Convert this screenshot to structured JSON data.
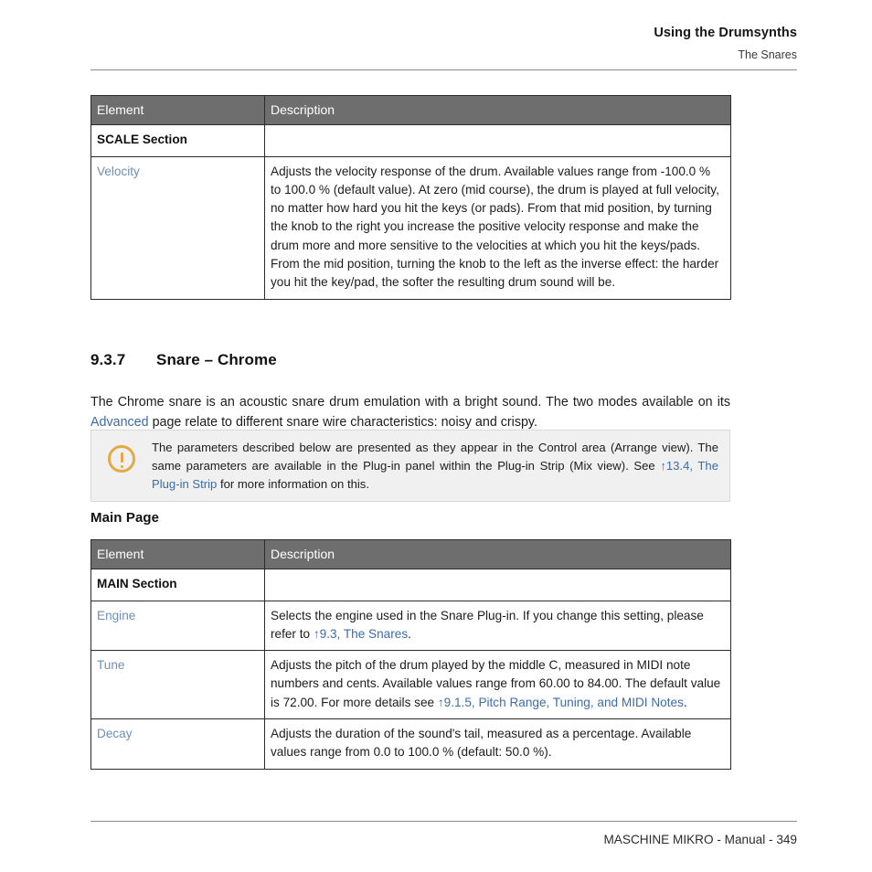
{
  "header": {
    "title": "Using the Drumsynths",
    "subtitle": "The Snares"
  },
  "tables": {
    "scale": {
      "columns": [
        "Element",
        "Description"
      ],
      "rows": [
        {
          "kind": "section",
          "element": "SCALE Section",
          "description": ""
        },
        {
          "kind": "param",
          "element": "Velocity",
          "description": "Adjusts the velocity response of the drum. Available values range from -100.0 % to 100.0 % (default value). At zero (mid course), the drum is played at full velocity, no matter how hard you hit the keys (or pads). From that mid position, by turning the knob to the right you increase the positive velocity response and make the drum more and more sensitive to the velocities at which you hit the keys/pads. From the mid position, turning the knob to the left as the inverse effect: the harder you hit the key/pad, the softer the resulting drum sound will be."
        }
      ]
    },
    "main": {
      "columns": [
        "Element",
        "Description"
      ],
      "rows": [
        {
          "kind": "section",
          "element": "MAIN Section",
          "description": ""
        },
        {
          "kind": "param",
          "element": "Engine",
          "description_parts": [
            {
              "type": "text",
              "value": "Selects the engine used in the Snare Plug-in. If you change this setting, please refer to "
            },
            {
              "type": "link",
              "value": "↑9.3, The Snares"
            },
            {
              "type": "text",
              "value": "."
            }
          ]
        },
        {
          "kind": "param",
          "element": "Tune",
          "description_parts": [
            {
              "type": "text",
              "value": "Adjusts the pitch of the drum played by the middle C, measured in MIDI note numbers and cents. Available values range from 60.00 to 84.00. The default value is 72.00. For more details see "
            },
            {
              "type": "link",
              "value": "↑9.1.5, Pitch Range, Tuning, and MIDI Notes"
            },
            {
              "type": "text",
              "value": "."
            }
          ]
        },
        {
          "kind": "param",
          "element": "Decay",
          "description_parts": [
            {
              "type": "text",
              "value": "Adjusts the duration of the sound's tail, measured as a percentage. Available values range from 0.0 to 100.0 % (default: 50.0 %)."
            }
          ]
        }
      ]
    }
  },
  "section": {
    "number": "9.3.7",
    "title": "Snare – Chrome",
    "intro_parts": [
      {
        "type": "text",
        "value": "The Chrome snare is an acoustic snare drum emulation with a bright sound. The two modes available on its "
      },
      {
        "type": "link",
        "value": "Advanced"
      },
      {
        "type": "text",
        "value": " page relate to different snare wire characteristics: noisy and crispy."
      }
    ]
  },
  "note": {
    "icon": "exclamation-circle-icon",
    "parts": [
      {
        "type": "text",
        "value": "The parameters described below are presented as they appear in the Control area (Arrange view). The same parameters are available in the Plug-in panel within the Plug-in Strip (Mix view). See "
      },
      {
        "type": "link",
        "value": "↑13.4, The Plug-in Strip"
      },
      {
        "type": "text",
        "value": " for more information on this."
      }
    ]
  },
  "subheading": "Main Page",
  "footer": {
    "text": "MASCHINE MIKRO - Manual - 349"
  },
  "colors": {
    "table_header_bg": "#6e6e6e",
    "link": "#3c6ca8",
    "element_link": "#6d8fb5",
    "note_bg": "#f0f0f0",
    "note_icon": "#e2a945",
    "rule": "#8d8d8d"
  }
}
